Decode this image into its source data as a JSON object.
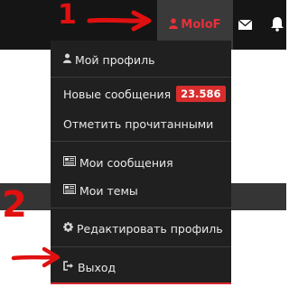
{
  "header": {
    "username": "MoloF",
    "icons": [
      "user-icon",
      "envelope-icon",
      "bell-icon"
    ]
  },
  "menu": {
    "my_profile": "Мой профиль",
    "new_messages": "Новые сообщения",
    "new_messages_count": "23.586",
    "mark_read": "Отметить прочитанными",
    "my_messages": "Мои сообщения",
    "my_topics": "Мои темы",
    "edit_profile": "Редактировать профиль",
    "logout": "Выход"
  },
  "annotations": {
    "num1": "1",
    "num2": "2"
  },
  "colors": {
    "accent": "#e8303b",
    "annotation": "#e01010",
    "badge": "#d92d2d",
    "menu_bg": "#202020"
  }
}
